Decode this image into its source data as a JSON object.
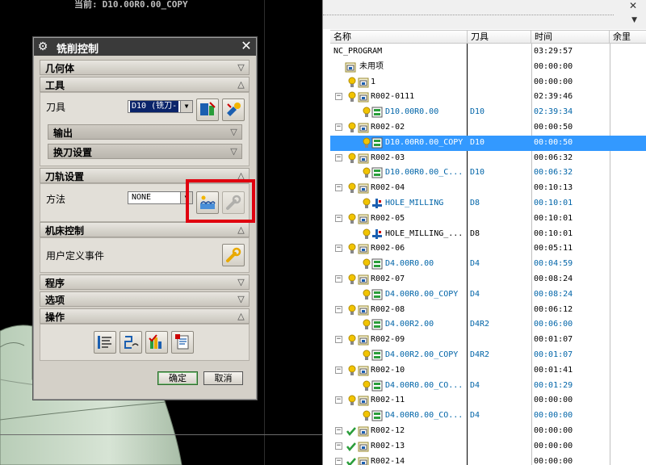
{
  "viewport": {
    "current_label": "当前:",
    "current_value": "D10.00R0.00_COPY"
  },
  "dialog": {
    "title": "铣削控制",
    "sections": {
      "geometry": "几何体",
      "tool": "工具",
      "output": "输出",
      "tool_change": "换刀设置",
      "path_settings": "刀轨设置",
      "machine_control": "机床控制",
      "program": "程序",
      "options": "选项",
      "actions": "操作"
    },
    "tool_label": "刀具",
    "tool_value": "D10 (铣刀-",
    "method_label": "方法",
    "method_value": "NONE",
    "user_event_label": "用户定义事件",
    "ok_label": "确定",
    "cancel_label": "取消"
  },
  "navigator": {
    "columns": [
      "名称",
      "刀具",
      "时间",
      "余里"
    ],
    "rows": [
      {
        "name": "NC_PROGRAM",
        "tool": "",
        "time": "03:29:57",
        "kind": "root"
      },
      {
        "name": "未用项",
        "tool": "",
        "time": "00:00:00",
        "kind": "group0"
      },
      {
        "name": "1",
        "tool": "",
        "time": "00:00:00",
        "kind": "group"
      },
      {
        "name": "R002-0111",
        "tool": "",
        "time": "02:39:46",
        "kind": "group"
      },
      {
        "name": "D10.00R0.00",
        "tool": "D10",
        "time": "02:39:34",
        "kind": "op"
      },
      {
        "name": "R002-02",
        "tool": "",
        "time": "00:00:50",
        "kind": "group"
      },
      {
        "name": "D10.00R0.00_COPY",
        "tool": "D10",
        "time": "00:00:50",
        "kind": "op",
        "selected": true
      },
      {
        "name": "R002-03",
        "tool": "",
        "time": "00:06:32",
        "kind": "group"
      },
      {
        "name": "D10.00R0.00_C...",
        "tool": "D10",
        "time": "00:06:32",
        "kind": "op"
      },
      {
        "name": "R002-04",
        "tool": "",
        "time": "00:10:13",
        "kind": "group"
      },
      {
        "name": "HOLE_MILLING",
        "tool": "D8",
        "time": "00:10:01",
        "kind": "hole"
      },
      {
        "name": "R002-05",
        "tool": "",
        "time": "00:10:01",
        "kind": "group"
      },
      {
        "name": "HOLE_MILLING_...",
        "tool": "D8",
        "time": "00:10:01",
        "kind": "hole",
        "black": true
      },
      {
        "name": "R002-06",
        "tool": "",
        "time": "00:05:11",
        "kind": "group"
      },
      {
        "name": "D4.00R0.00",
        "tool": "D4",
        "time": "00:04:59",
        "kind": "op"
      },
      {
        "name": "R002-07",
        "tool": "",
        "time": "00:08:24",
        "kind": "group"
      },
      {
        "name": "D4.00R0.00_COPY",
        "tool": "D4",
        "time": "00:08:24",
        "kind": "op"
      },
      {
        "name": "R002-08",
        "tool": "",
        "time": "00:06:12",
        "kind": "group"
      },
      {
        "name": "D4.00R2.00",
        "tool": "D4R2",
        "time": "00:06:00",
        "kind": "op"
      },
      {
        "name": "R002-09",
        "tool": "",
        "time": "00:01:07",
        "kind": "group"
      },
      {
        "name": "D4.00R2.00_COPY",
        "tool": "D4R2",
        "time": "00:01:07",
        "kind": "op"
      },
      {
        "name": "R002-10",
        "tool": "",
        "time": "00:01:41",
        "kind": "group"
      },
      {
        "name": "D4.00R0.00_CO...",
        "tool": "D4",
        "time": "00:01:29",
        "kind": "op"
      },
      {
        "name": "R002-11",
        "tool": "",
        "time": "00:00:00",
        "kind": "group"
      },
      {
        "name": "D4.00R0.00_CO...",
        "tool": "D4",
        "time": "00:00:00",
        "kind": "op"
      },
      {
        "name": "R002-12",
        "tool": "",
        "time": "00:00:00",
        "kind": "check"
      },
      {
        "name": "R002-13",
        "tool": "",
        "time": "00:00:00",
        "kind": "check"
      },
      {
        "name": "R002-14",
        "tool": "",
        "time": "00:00:00",
        "kind": "check"
      }
    ]
  },
  "colors": {
    "selection": "#3399ff",
    "op_text": "#0064a8",
    "highlight_box": "#e0000f",
    "dialog_bg": "#d4d0c8"
  },
  "icons": {
    "dialog": "gear-icon",
    "close": "close-icon",
    "bulb": "lightbulb-icon",
    "group": "program-group-icon",
    "op": "operation-icon",
    "hole": "hole-milling-icon",
    "check": "check-icon"
  }
}
